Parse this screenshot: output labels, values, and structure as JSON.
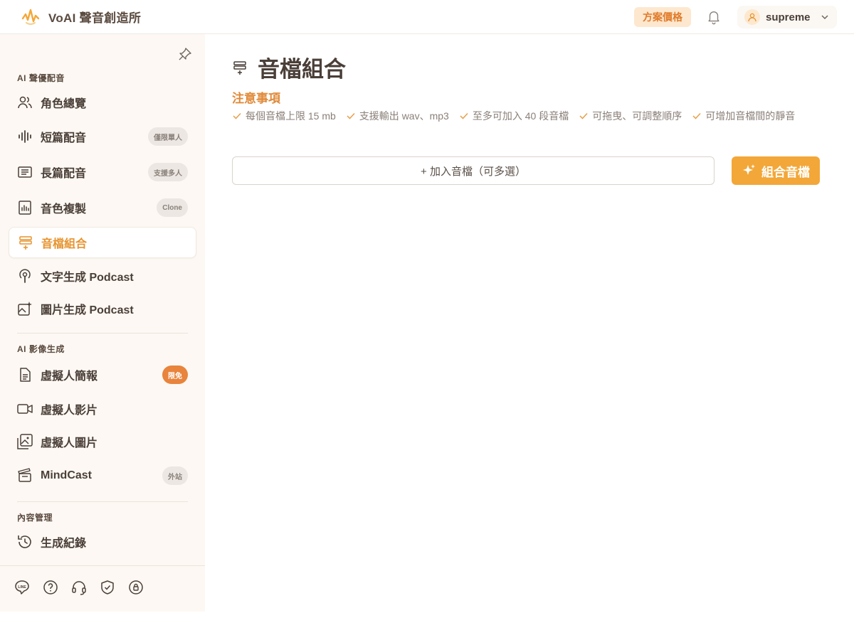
{
  "colors": {
    "accent": "#f3a738",
    "accent_text": "#e6932f",
    "sidebar_bg": "#fdf8f3",
    "text": "#4a3f38",
    "badge_hot": "#e8843c"
  },
  "header": {
    "brand_name": "VoAI 聲音創造所",
    "pricing_label": "方案價格",
    "username": "supreme"
  },
  "sidebar": {
    "sections": [
      {
        "title": "AI 聲優配音"
      },
      {
        "title": "AI 影像生成"
      },
      {
        "title": "內容管理"
      }
    ],
    "items": [
      {
        "label": "角色總覽",
        "icon": "users-icon"
      },
      {
        "label": "短篇配音",
        "icon": "waveform-icon",
        "badge": "僅限單人"
      },
      {
        "label": "長篇配音",
        "icon": "document-lines-icon",
        "badge": "支援多人"
      },
      {
        "label": "音色複製",
        "icon": "voice-clone-icon",
        "badge": "Clone"
      },
      {
        "label": "音檔組合",
        "icon": "audio-combine-icon",
        "active": true
      },
      {
        "label": "文字生成 Podcast",
        "icon": "podcast-icon"
      },
      {
        "label": "圖片生成 Podcast",
        "icon": "image-sparkle-icon"
      },
      {
        "label": "虛擬人簡報",
        "icon": "file-icon",
        "badge": "限免"
      },
      {
        "label": "虛擬人影片",
        "icon": "video-icon"
      },
      {
        "label": "虛擬人圖片",
        "icon": "image-icon"
      },
      {
        "label": "MindCast",
        "icon": "clapper-icon",
        "badge": "外站"
      },
      {
        "label": "生成紀錄",
        "icon": "history-icon"
      }
    ],
    "bottom_icons": [
      "line-icon",
      "help-icon",
      "headset-icon",
      "shield-icon",
      "privacy-icon"
    ]
  },
  "main": {
    "title": "音檔組合",
    "notice_title": "注意事項",
    "notices": [
      "每個音檔上限 15 mb",
      "支援輸出 wav、mp3",
      "至多可加入 40 段音檔",
      "可拖曳、可調整順序",
      "可增加音檔間的靜音"
    ],
    "add_button_label": "+ 加入音檔（可多選）",
    "combine_button_label": "組合音檔"
  }
}
